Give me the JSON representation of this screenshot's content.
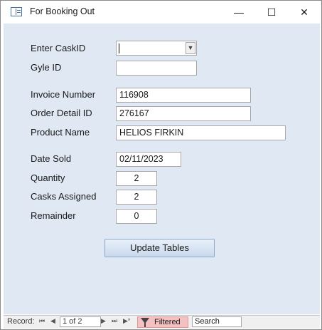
{
  "window": {
    "title": "For Booking Out",
    "minimize_glyph": "—",
    "maximize_glyph": "☐",
    "close_glyph": "✕",
    "title_icon": "form-icon"
  },
  "form": {
    "cask_id": {
      "label": "Enter CaskID",
      "value": ""
    },
    "gyle_id": {
      "label": "Gyle ID",
      "value": ""
    },
    "invoice_number": {
      "label": "Invoice Number",
      "value": "116908"
    },
    "order_detail_id": {
      "label": "Order Detail ID",
      "value": "276167"
    },
    "product_name": {
      "label": "Product Name",
      "value": "HELIOS FIRKIN"
    },
    "date_sold": {
      "label": "Date Sold",
      "value": "02/11/2023"
    },
    "quantity": {
      "label": "Quantity",
      "value": "2"
    },
    "casks_assigned": {
      "label": "Casks Assigned",
      "value": "2"
    },
    "remainder": {
      "label": "Remainder",
      "value": "0"
    },
    "update_button": "Update Tables"
  },
  "navigation": {
    "record_label": "Record:",
    "first_glyph": "⏮",
    "prev_glyph": "◀",
    "current": "1 of 2",
    "next_glyph": "▶",
    "last_glyph": "⏭",
    "filter_label": "Filtered",
    "search_label": "Search"
  }
}
